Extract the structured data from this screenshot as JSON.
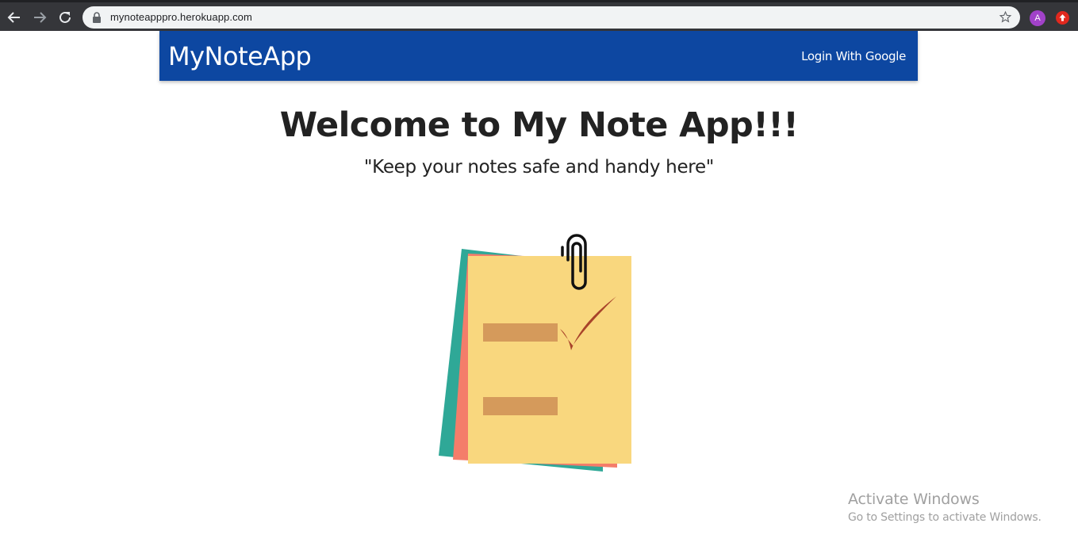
{
  "browser": {
    "url": "mynoteapppro.herokuapp.com",
    "avatar_letter": "A",
    "icons": [
      "back-icon",
      "forward-icon",
      "reload-icon",
      "lock-icon",
      "star-icon",
      "extension-icon"
    ]
  },
  "navbar": {
    "brand": "MyNoteApp",
    "login_label": "Login With Google",
    "color": "#0d47a1"
  },
  "main": {
    "title": "Welcome to My Note App!!!",
    "subtitle": "\"Keep your notes safe and handy here\""
  },
  "illustration": {
    "icon": "sticky-notes-icon",
    "colors": [
      "#2fa897",
      "#f47d6a",
      "#f9d77e",
      "#d59a5b",
      "#a8432a"
    ]
  },
  "watermark": {
    "title": "Activate Windows",
    "subtitle": "Go to Settings to activate Windows."
  }
}
